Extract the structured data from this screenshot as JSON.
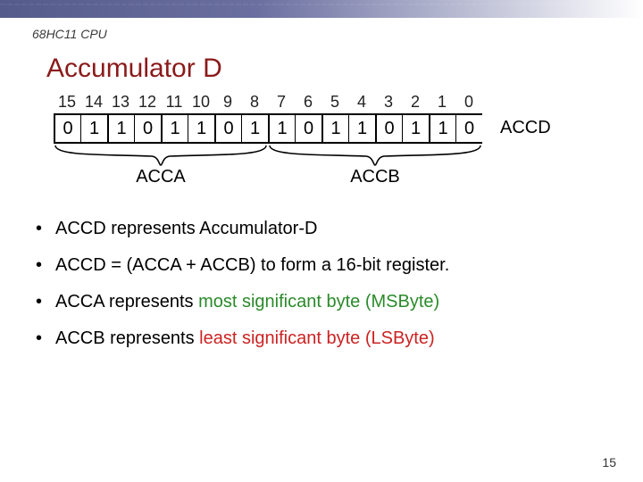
{
  "header": "68HC11 CPU",
  "title": "Accumulator D",
  "bit_indices": [
    "15",
    "14",
    "13",
    "12",
    "11",
    "10",
    "9",
    "8",
    "7",
    "6",
    "5",
    "4",
    "3",
    "2",
    "1",
    "0"
  ],
  "bits": [
    "0",
    "1",
    "1",
    "0",
    "1",
    "1",
    "0",
    "1",
    "1",
    "0",
    "1",
    "1",
    "0",
    "1",
    "1",
    "0"
  ],
  "labels": {
    "accd": "ACCD",
    "acca": "ACCA",
    "accb": "ACCB"
  },
  "bullets": {
    "b1_pre": "ACCD  represents Accumulator-D",
    "b2": "ACCD  = (ACCA + ACCB) to form a 16-bit register.",
    "b3_plain": "ACCA represents  ",
    "b3_green": "most significant byte (MSByte)",
    "b4_plain": "ACCB represents ",
    "b4_red": "least significant byte (LSByte)"
  },
  "pagenum": "15"
}
